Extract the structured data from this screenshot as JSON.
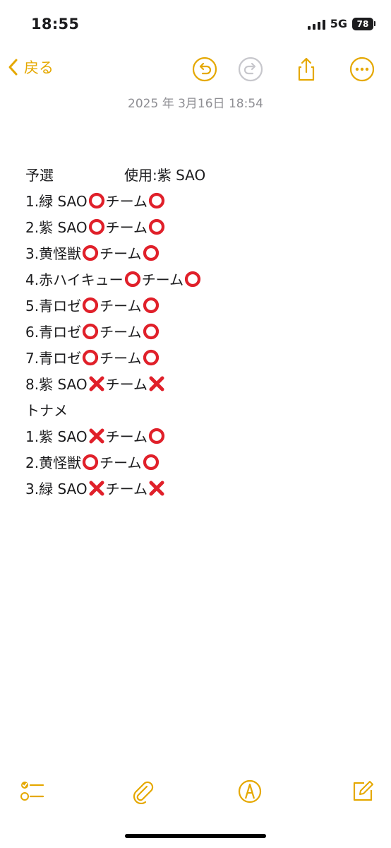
{
  "status_bar": {
    "time": "18:55",
    "network": "5G",
    "battery_level": "78"
  },
  "nav": {
    "back_label": "戻る",
    "timestamp": "2025 年 3月16日 18:54",
    "icons": [
      "undo-icon",
      "redo-icon",
      "share-icon",
      "more-icon"
    ]
  },
  "note": {
    "lines": [
      {
        "text": "予選　　　　　使用:紫 SAO",
        "marks": []
      },
      {
        "text": "1.緑 SAO",
        "marks": [
          "circle"
        ],
        "suffix": "チーム",
        "end": "circle"
      },
      {
        "text": "2.紫 SAO",
        "marks": [
          "circle"
        ],
        "suffix": "チーム",
        "end": "circle"
      },
      {
        "text": "3.黄怪獣",
        "marks": [
          "circle"
        ],
        "suffix": "チーム",
        "end": "circle"
      },
      {
        "text": "4.赤ハイキュー",
        "marks": [
          "circle"
        ],
        "suffix": "チーム",
        "end": "circle"
      },
      {
        "text": "5.青ロゼ",
        "marks": [
          "circle"
        ],
        "suffix": "チーム",
        "end": "circle"
      },
      {
        "text": "6.青ロゼ",
        "marks": [
          "circle"
        ],
        "suffix": "チーム",
        "end": "circle"
      },
      {
        "text": "7.青ロゼ",
        "marks": [
          "circle"
        ],
        "suffix": "チーム",
        "end": "circle"
      },
      {
        "text": "8.紫 SAO",
        "marks": [
          "cross"
        ],
        "suffix": "チーム",
        "end": "cross"
      },
      {
        "text": "トナメ",
        "marks": []
      },
      {
        "text": "1.紫 SAO",
        "marks": [
          "cross"
        ],
        "suffix": "チーム",
        "end": "circle"
      },
      {
        "text": "2.黄怪獣",
        "marks": [
          "circle"
        ],
        "suffix": "チーム",
        "end": "circle"
      },
      {
        "text": "3.緑 SAO",
        "marks": [
          "cross"
        ],
        "suffix": "チーム",
        "end": "cross"
      }
    ]
  },
  "toolbar": {
    "icons": [
      "checklist-icon",
      "attachment-icon",
      "markup-icon",
      "compose-icon"
    ]
  },
  "colors": {
    "accent": "#e5a800",
    "mark_red": "#e0202a",
    "text": "#1c1c1e",
    "secondary": "#8e8e93"
  }
}
